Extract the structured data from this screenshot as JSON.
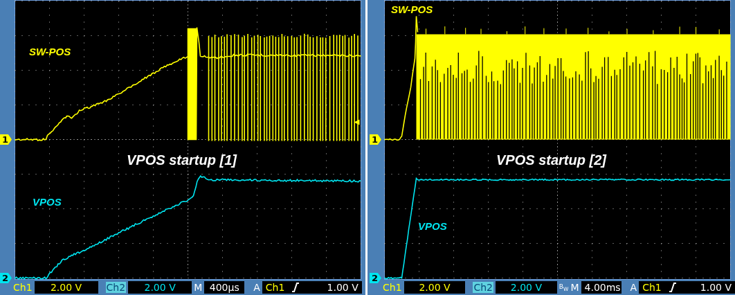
{
  "panels": [
    {
      "title": "VPOS startup [1]",
      "trigger_level_marker": true,
      "channels": [
        {
          "marker": "1",
          "label": "SW-POS"
        },
        {
          "marker": "2",
          "label": "VPOS"
        }
      ],
      "readout": {
        "ch1_label": "Ch1",
        "ch1_scale": "2.00 V",
        "ch2_label": "Ch2",
        "ch2_scale": "2.00 V",
        "timebase_label": "M",
        "timebase": "400µs",
        "trigger_label": "A",
        "trigger_source": "Ch1",
        "trigger_level": "1.00 V"
      }
    },
    {
      "title": "VPOS startup [2]",
      "trigger_level_marker": false,
      "channels": [
        {
          "marker": "1",
          "label": "SW-POS"
        },
        {
          "marker": "2",
          "label": "VPOS"
        }
      ],
      "readout": {
        "ch1_label": "Ch1",
        "ch1_scale": "2.00 V",
        "ch2_label": "Ch2",
        "ch2_scale": "2.00 V",
        "bw": "B$_{W}$",
        "timebase_label": "M",
        "timebase": "4.00ms",
        "trigger_label": "A",
        "trigger_source": "Ch1",
        "trigger_level": "1.00 V"
      }
    }
  ]
}
